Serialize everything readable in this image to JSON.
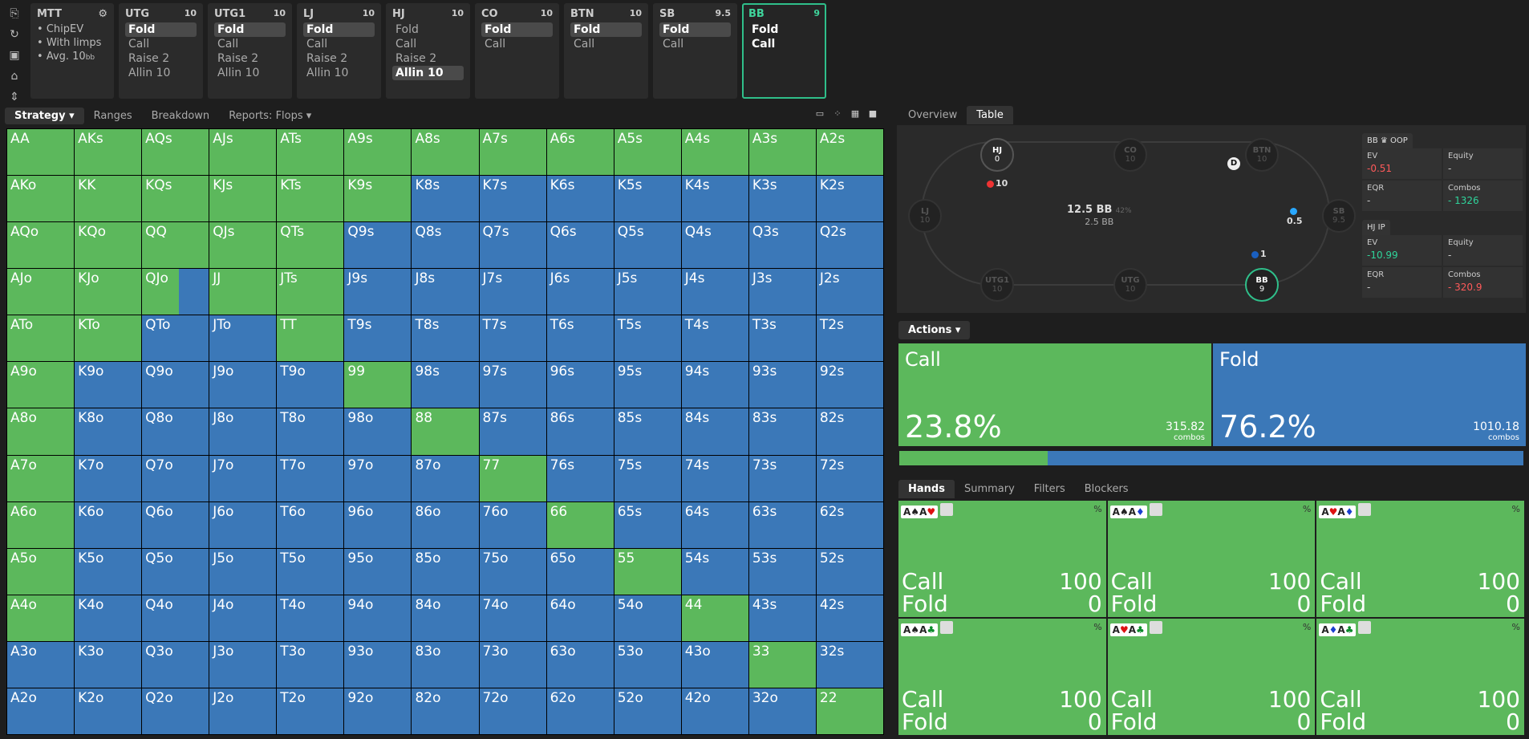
{
  "rail_icons": [
    "bookmark-icon",
    "history-icon",
    "save-icon",
    "game-icon",
    "spacing-icon"
  ],
  "mtt": {
    "title": "MTT",
    "gear": "⚙",
    "lines": [
      "ChipEV",
      "With limps",
      "Avg. 10"
    ],
    "avg_unit": "bb"
  },
  "positions": [
    {
      "name": "UTG",
      "stack": "10",
      "actions": [
        "Fold",
        "Call",
        "Raise 2",
        "Allin 10"
      ],
      "selected": 0
    },
    {
      "name": "UTG1",
      "stack": "10",
      "actions": [
        "Fold",
        "Call",
        "Raise 2",
        "Allin 10"
      ],
      "selected": 0
    },
    {
      "name": "LJ",
      "stack": "10",
      "actions": [
        "Fold",
        "Call",
        "Raise 2",
        "Allin 10"
      ],
      "selected": 0
    },
    {
      "name": "HJ",
      "stack": "10",
      "actions": [
        "Fold",
        "Call",
        "Raise 2",
        "Allin 10"
      ],
      "selected": 3
    },
    {
      "name": "CO",
      "stack": "10",
      "actions": [
        "Fold",
        "Call"
      ],
      "selected": 0
    },
    {
      "name": "BTN",
      "stack": "10",
      "actions": [
        "Fold",
        "Call"
      ],
      "selected": 0
    },
    {
      "name": "SB",
      "stack": "9.5",
      "actions": [
        "Fold",
        "Call"
      ],
      "selected": 0
    },
    {
      "name": "BB",
      "stack": "9",
      "actions": [
        "Fold",
        "Call"
      ],
      "selected": -1,
      "active": true
    }
  ],
  "left_tabs": [
    "Strategy",
    "Ranges",
    "Breakdown",
    "Reports: Flops"
  ],
  "right_tabs": [
    "Overview",
    "Table"
  ],
  "grid_green": [
    "AA",
    "AKs",
    "AQs",
    "AJs",
    "ATs",
    "A9s",
    "A8s",
    "A7s",
    "A6s",
    "A5s",
    "A4s",
    "A3s",
    "A2s",
    "AKo",
    "KK",
    "KQs",
    "KJs",
    "KTs",
    "K9s",
    "AQo",
    "KQo",
    "QQ",
    "QJs",
    "QTs",
    "AJo",
    "KJo",
    "QJo",
    "JJ",
    "JTs",
    "ATo",
    "KTo",
    "TT",
    "A9o",
    "99",
    "A8o",
    "88",
    "A7o",
    "77",
    "A6o",
    "66",
    "A5o",
    "55",
    "A4o",
    "44",
    "33",
    "22"
  ],
  "grid_mixed": [
    "QJo"
  ],
  "table": {
    "pot": "12.5 BB",
    "pot_pct": "42%",
    "sub": "2.5 BB",
    "seats": [
      {
        "name": "HJ",
        "stack": "0"
      },
      {
        "name": "CO",
        "stack": "10"
      },
      {
        "name": "BTN",
        "stack": "10"
      },
      {
        "name": "SB",
        "stack": "9.5"
      },
      {
        "name": "BB",
        "stack": "9"
      },
      {
        "name": "UTG",
        "stack": "10"
      },
      {
        "name": "UTG1",
        "stack": "10"
      },
      {
        "name": "LJ",
        "stack": "10"
      }
    ],
    "hj_bet": "10",
    "sb_bet": "0.5",
    "bb_bet": "1",
    "dealer": "D"
  },
  "info": [
    {
      "head": "BB ♛ OOP",
      "ev": "-0.51",
      "equity": "-",
      "eqr": "-",
      "combos": "- 1326",
      "ev_class": "neg",
      "combos_class": "pos"
    },
    {
      "head": "HJ IP",
      "ev": "-10.99",
      "equity": "-",
      "eqr": "-",
      "combos": "- 320.9",
      "ev_class": "pos",
      "combos_class": "neg"
    }
  ],
  "info_labels": {
    "ev": "EV",
    "equity": "Equity",
    "eqr": "EQR",
    "combos": "Combos"
  },
  "actions_label": "Actions",
  "actions": [
    {
      "name": "Call",
      "pct": "23.8%",
      "combos": "315.82",
      "color": "#5cb85c",
      "freq": 23.8
    },
    {
      "name": "Fold",
      "pct": "76.2%",
      "combos": "1010.18",
      "color": "#3b78b8",
      "freq": 76.2
    }
  ],
  "combos_word": "combos",
  "bottom_tabs": [
    "Hands",
    "Summary",
    "Filters",
    "Blockers"
  ],
  "hands": [
    {
      "c1": "A",
      "s1": "♠",
      "k1": "blk",
      "c2": "A",
      "s2": "♥",
      "k2": "red",
      "call": "100",
      "fold": "0"
    },
    {
      "c1": "A",
      "s1": "♠",
      "k1": "blk",
      "c2": "A",
      "s2": "♦",
      "k2": "blu",
      "call": "100",
      "fold": "0"
    },
    {
      "c1": "A",
      "s1": "♥",
      "k1": "red",
      "c2": "A",
      "s2": "♦",
      "k2": "blu",
      "call": "100",
      "fold": "0"
    },
    {
      "c1": "A",
      "s1": "♠",
      "k1": "blk",
      "c2": "A",
      "s2": "♣",
      "k2": "grn",
      "call": "100",
      "fold": "0"
    },
    {
      "c1": "A",
      "s1": "♥",
      "k1": "red",
      "c2": "A",
      "s2": "♣",
      "k2": "grn",
      "call": "100",
      "fold": "0"
    },
    {
      "c1": "A",
      "s1": "♦",
      "k1": "blu",
      "c2": "A",
      "s2": "♣",
      "k2": "grn",
      "call": "100",
      "fold": "0"
    }
  ],
  "hand_labels": {
    "call": "Call",
    "fold": "Fold",
    "pct": "%"
  }
}
